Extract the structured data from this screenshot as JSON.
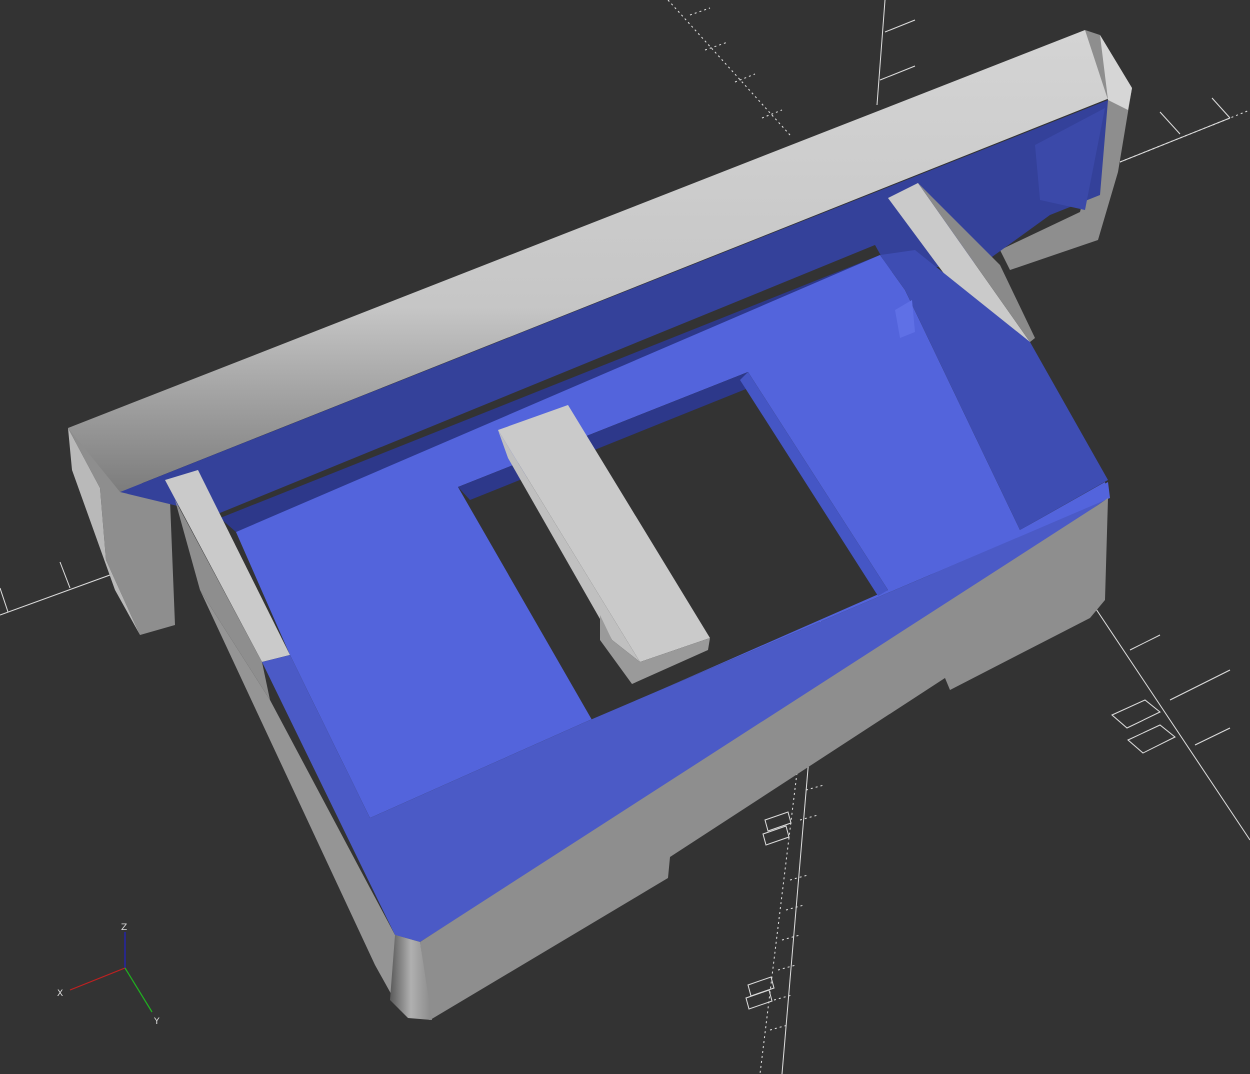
{
  "viewport": {
    "background_color": "#333333",
    "model_face_color": "#5364DC",
    "model_shadow_color": "#34419A",
    "model_wall_color": "#8E8E8E",
    "model_top_color": "#CACACA"
  },
  "axes": {
    "x_label": "X",
    "y_label": "Y",
    "z_label": "Z",
    "x_color": "#C02020",
    "y_color": "#20B020",
    "z_color": "#2020C0"
  }
}
